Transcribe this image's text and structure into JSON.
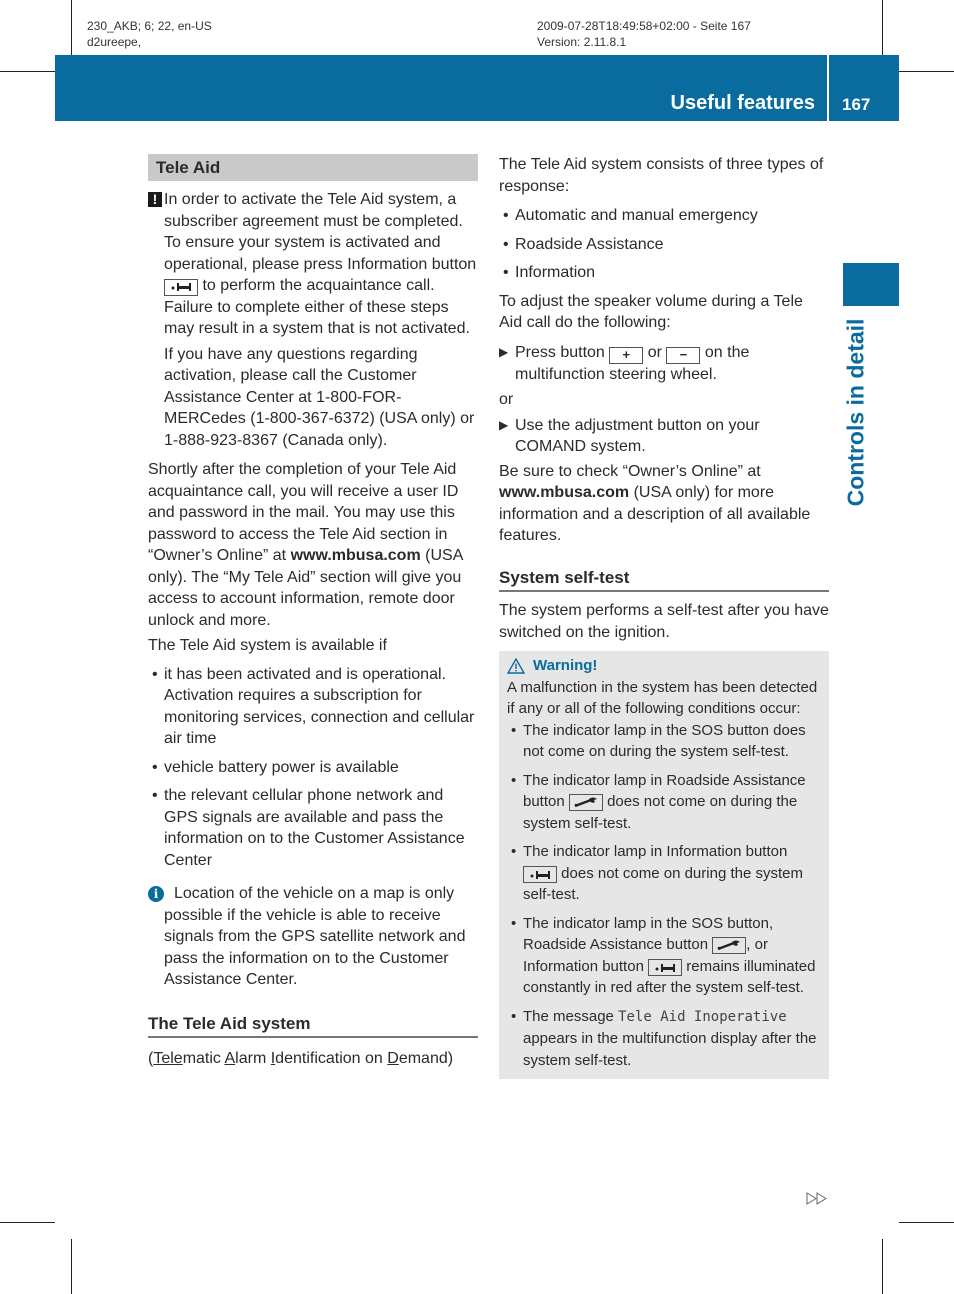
{
  "print_meta": {
    "left_line1": "230_AKB; 6; 22, en-US",
    "left_line2": "d2ureepe,",
    "right_line1": "2009-07-28T18:49:58+02:00 - Seite 167",
    "right_line2": "Version: 2.11.8.1"
  },
  "header": {
    "section_title": "Useful features",
    "page_number": "167",
    "accent_color": "#0a6c9e"
  },
  "side_tab": {
    "label": "Controls in detail"
  },
  "left": {
    "section_heading": "Tele Aid",
    "notice": {
      "icon": "exclamation-icon",
      "text_part1": "In order to activate the Tele Aid system, a subscriber agreement must be completed. To ensure your system is activated and operational, please press Information button",
      "text_part2": "to perform the acquaintance call. Failure to complete either of these steps may result in a system that is not activated.",
      "followup": "If you have any questions regarding activation, please call the Customer Assistance Center at 1-800-FOR-MERCedes (1-800-367-6372) (USA only) or 1-888-923-8367 (Canada only)."
    },
    "para1_part1": "Shortly after the completion of your Tele Aid acquaintance call, you will receive a user ID and password in the mail. You may use this password to access the Tele Aid section in “Owner’s Online” at",
    "para1_url": "www.mbusa.com",
    "para1_part2": "(USA only). The “My Tele Aid” section will give you access to account information, remote door unlock and more.",
    "para2": "The Tele Aid system is available if",
    "availability_bullets": [
      "it has been activated and is operational. Activation requires a subscription for monitoring services, connection and cellular air time",
      "vehicle battery power is available",
      "the relevant cellular phone network and GPS signals are available and pass the information on to the Customer Assistance Center"
    ],
    "info_note": "Location of the vehicle on a map is only possible if the vehicle is able to receive signals from the GPS satellite network and pass the information on to the Customer Assistance Center.",
    "subheading": "The Tele Aid system",
    "acronym": {
      "open": "(",
      "parts": [
        {
          "u": "Tele",
          "rest": "matic "
        },
        {
          "u": "A",
          "rest": "larm "
        },
        {
          "u": "I",
          "rest": "dentification on "
        },
        {
          "u": "D",
          "rest": "emand"
        }
      ],
      "close": ")"
    }
  },
  "right": {
    "intro": "The Tele Aid system consists of three types of response:",
    "response_types": [
      "Automatic and manual emergency",
      "Roadside Assistance",
      "Information"
    ],
    "volume_intro": "To adjust the speaker volume during a Tele Aid call do the following:",
    "step1_part1": "Press button",
    "plus_button": "+",
    "step1_or": "or",
    "minus_button": "−",
    "step1_part2": "on the multifunction steering wheel.",
    "or_label": "or",
    "step2": "Use the adjustment button on your COMAND system.",
    "check_part1": "Be sure to check “Owner’s Online” at",
    "check_url": "www.mbusa.com",
    "check_part2": "(USA only) for more information and a description of all available features.",
    "subheading": "System self-test",
    "selftest_text": "The system performs a self-test after you have switched on the ignition.",
    "warning": {
      "title": "Warning!",
      "intro": "A malfunction in the system has been detected if any or all of the following conditions occur:",
      "b1": "The indicator lamp in the SOS button does not come on during the system self-test.",
      "b2_part1": "The indicator lamp in Roadside Assistance button",
      "b2_part2": "does not come on during the system self-test.",
      "b3_part1": "The indicator lamp in Information button",
      "b3_part2": "does not come on during the system self-test.",
      "b4_part1": "The indicator lamp in the SOS button, Roadside Assistance button",
      "b4_part2": ", or Information button",
      "b4_part3": "remains illuminated constantly in red after the system self-test.",
      "b5_part1": "The message",
      "b5_display": "Tele Aid Inoperative",
      "b5_part2": "appears in the multifunction display after the system self-test."
    }
  },
  "footer": {
    "continue_icon": "continue-arrows-icon"
  }
}
